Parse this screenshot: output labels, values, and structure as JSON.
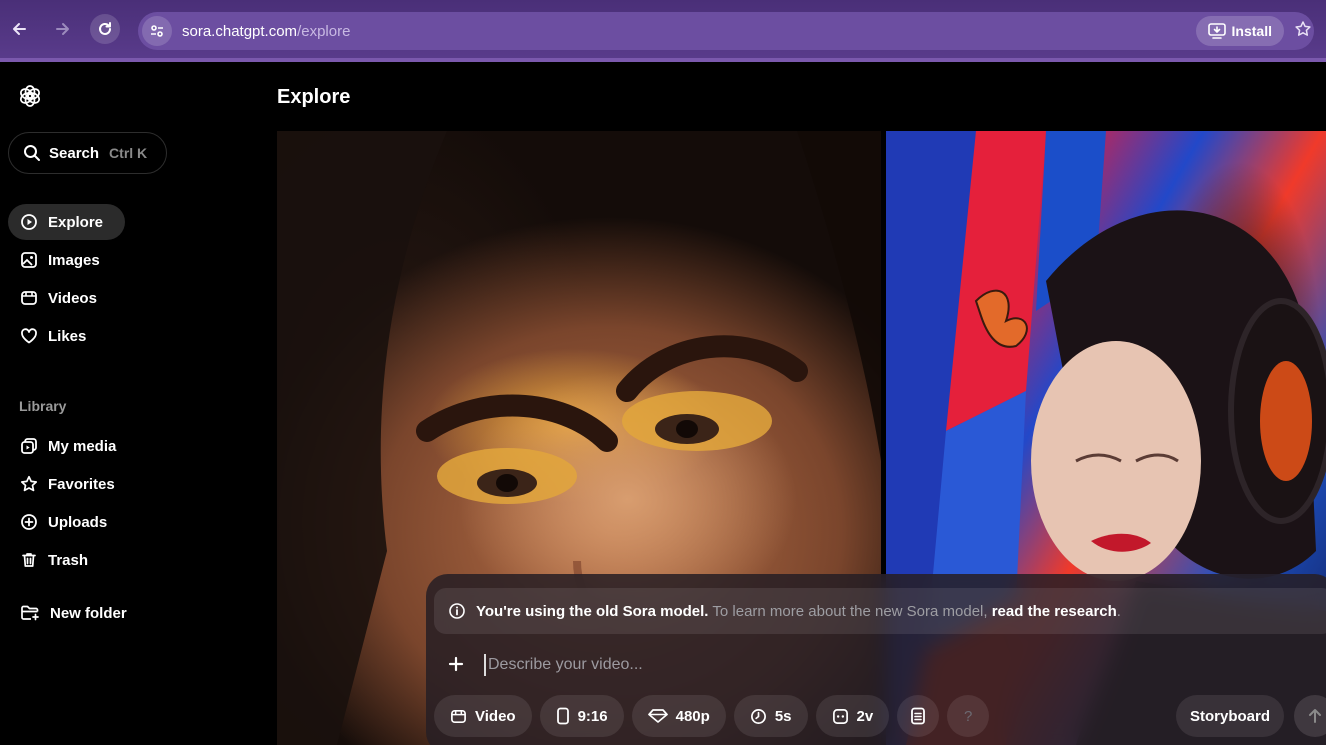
{
  "browser": {
    "url_host": "sora.chatgpt.com",
    "url_path": "/explore",
    "install_label": "Install"
  },
  "sidebar": {
    "search_label": "Search",
    "search_shortcut": "Ctrl K",
    "nav": [
      {
        "label": "Explore",
        "icon": "play-circle-icon",
        "active": true
      },
      {
        "label": "Images",
        "icon": "image-icon"
      },
      {
        "label": "Videos",
        "icon": "video-icon"
      },
      {
        "label": "Likes",
        "icon": "heart-icon"
      }
    ],
    "library_label": "Library",
    "library": [
      {
        "label": "My media",
        "icon": "media-icon"
      },
      {
        "label": "Favorites",
        "icon": "star-icon"
      },
      {
        "label": "Uploads",
        "icon": "plus-circle-icon"
      },
      {
        "label": "Trash",
        "icon": "trash-icon"
      }
    ],
    "new_folder_label": "New folder"
  },
  "main": {
    "title": "Explore"
  },
  "composer": {
    "notice_strong": "You're using the old Sora model.",
    "notice_text": " To learn more about the new Sora model, ",
    "notice_link": "read the research",
    "notice_end": ".",
    "prompt_placeholder": "Describe your video...",
    "chips": {
      "type": "Video",
      "aspect": "9:16",
      "resolution": "480p",
      "duration": "5s",
      "variations": "2v",
      "help": "?"
    },
    "storyboard_label": "Storyboard"
  },
  "colors": {
    "chrome_bg": "#4a2f78",
    "omnibox_bg": "#6c4ea1",
    "active_nav_bg": "#2b2b2b"
  }
}
